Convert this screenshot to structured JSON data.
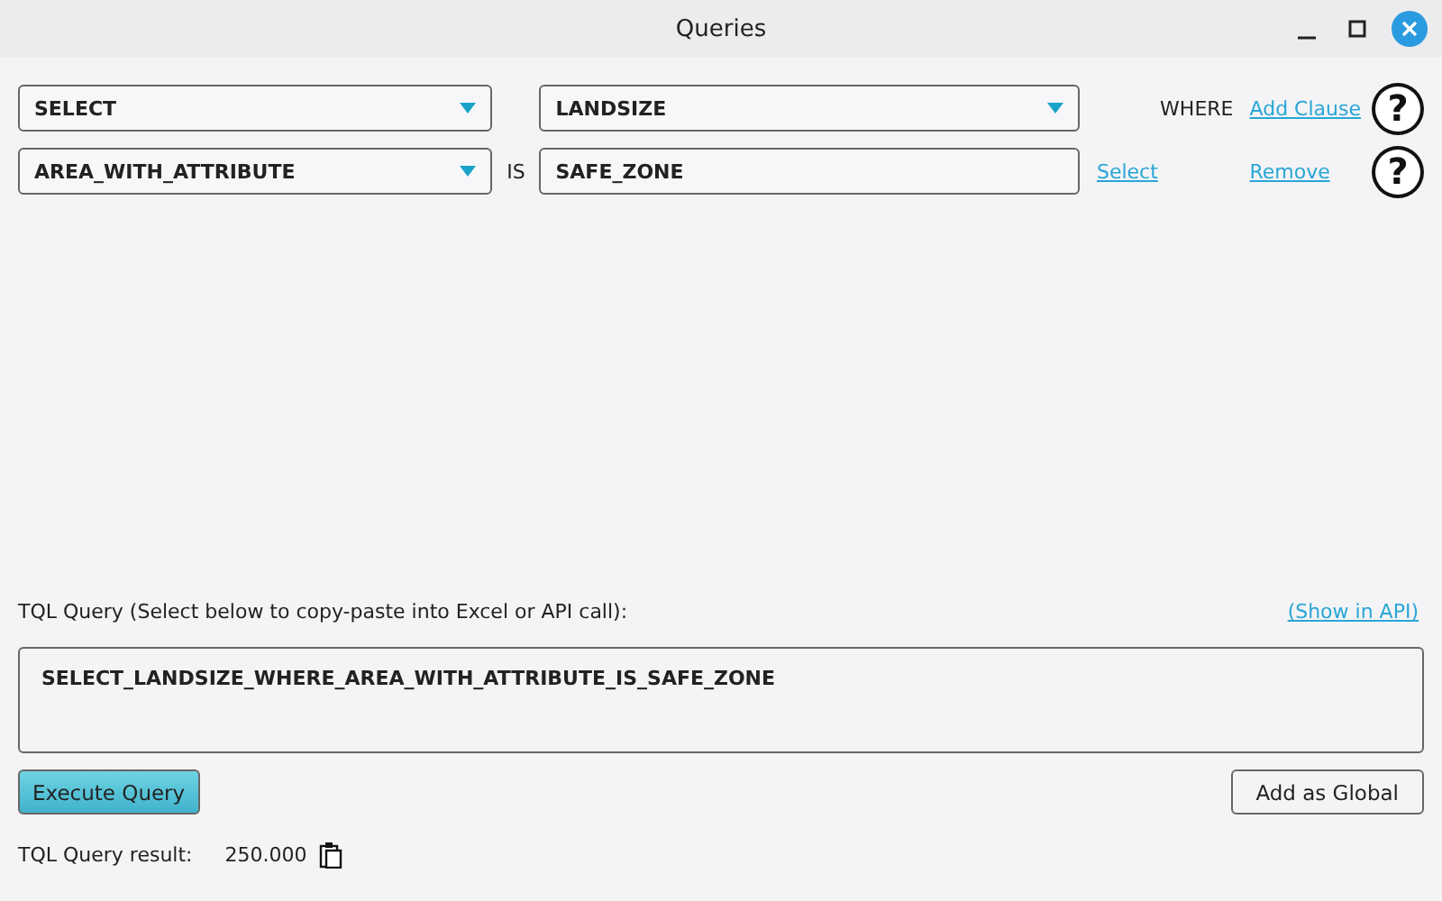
{
  "window": {
    "title": "Queries"
  },
  "clauses": [
    {
      "kind": "select",
      "operator": {
        "value": "SELECT"
      },
      "field": {
        "kind": "dropdown",
        "value": "LANDSIZE"
      },
      "keyword": "WHERE",
      "action": "Add Clause",
      "help": "?"
    },
    {
      "kind": "condition",
      "operator": {
        "value": "AREA_WITH_ATTRIBUTE"
      },
      "keyword": "IS",
      "field": {
        "kind": "text",
        "value": "SAFE_ZONE"
      },
      "picker": "Select",
      "action": "Remove",
      "help": "?"
    }
  ],
  "query": {
    "label": "TQL Query (Select below to copy-paste into Excel or API call):",
    "link": "(Show in API)",
    "text": "SELECT_LANDSIZE_WHERE_AREA_WITH_ATTRIBUTE_IS_SAFE_ZONE"
  },
  "buttons": [
    {
      "kind": "primary",
      "label": "Execute Query"
    },
    {
      "kind": "secondary",
      "label": "Add as Global"
    }
  ],
  "result": {
    "label": "TQL Query result:",
    "value": "250.000"
  }
}
